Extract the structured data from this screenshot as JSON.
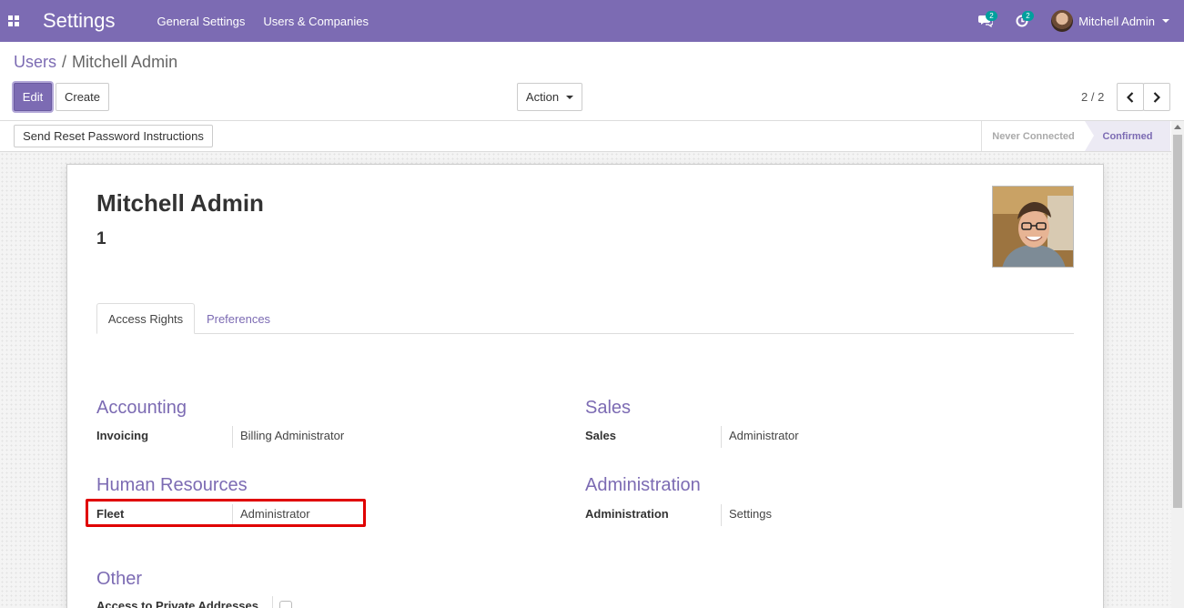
{
  "navbar": {
    "app_title": "Settings",
    "menus": [
      "General Settings",
      "Users & Companies"
    ],
    "messages_count": "2",
    "activities_count": "2",
    "user_name": "Mitchell Admin"
  },
  "breadcrumb": {
    "parent": "Users",
    "separator": "/",
    "current": "Mitchell Admin"
  },
  "control_panel": {
    "edit_label": "Edit",
    "create_label": "Create",
    "action_label": "Action",
    "pager": "2 / 2"
  },
  "statusbar": {
    "reset_password_label": "Send Reset Password Instructions",
    "stages": [
      "Never Connected",
      "Confirmed"
    ],
    "current_stage": "Confirmed"
  },
  "form": {
    "name": "Mitchell Admin",
    "login": "1",
    "tabs": [
      "Access Rights",
      "Preferences"
    ],
    "active_tab": "Access Rights",
    "groups": {
      "accounting": {
        "title": "Accounting",
        "label": "Invoicing",
        "value": "Billing Administrator"
      },
      "sales": {
        "title": "Sales",
        "label": "Sales",
        "value": "Administrator"
      },
      "hr": {
        "title": "Human Resources",
        "label": "Fleet",
        "value": "Administrator"
      },
      "administration": {
        "title": "Administration",
        "label": "Administration",
        "value": "Settings"
      },
      "other": {
        "title": "Other",
        "label": "Access to Private Addresses"
      }
    }
  },
  "colors": {
    "brand": "#7c6bb3",
    "highlight": "#e00000",
    "badge": "#00a09d"
  }
}
